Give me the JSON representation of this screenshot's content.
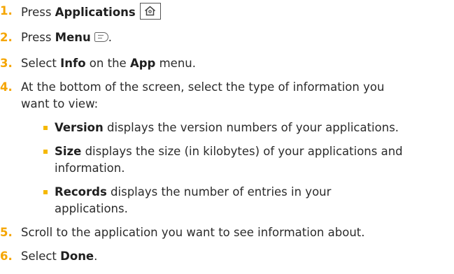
{
  "colors": {
    "step_number": "#f5a500",
    "bullet": "#f5b800",
    "text": "#2b2b2b"
  },
  "steps": [
    {
      "num": "1.",
      "pre": "Press ",
      "bold": "Applications",
      "post": "",
      "icon": "home-key-icon"
    },
    {
      "num": "2.",
      "pre": "Press ",
      "bold": "Menu",
      "post": ".",
      "icon": "menu-key-icon"
    },
    {
      "num": "3.",
      "pre": "Select ",
      "bold": "Info",
      "mid": " on the ",
      "bold2": "App",
      "post": " menu."
    },
    {
      "num": "4.",
      "line1": "At the bottom of the screen, select the type of information you",
      "line2": "want to view:"
    },
    {
      "num": "5.",
      "text": "Scroll to the application you want to see information about."
    },
    {
      "num": "6.",
      "pre": "Select ",
      "bold": "Done",
      "post": "."
    }
  ],
  "bullets": [
    {
      "bold": "Version",
      "rest": " displays the version numbers of your applications."
    },
    {
      "bold": "Size",
      "rest": " displays the size (in kilobytes) of your applications and",
      "cont": "information."
    },
    {
      "bold": "Records",
      "rest": " displays the number of entries in your",
      "cont": "applications."
    }
  ]
}
